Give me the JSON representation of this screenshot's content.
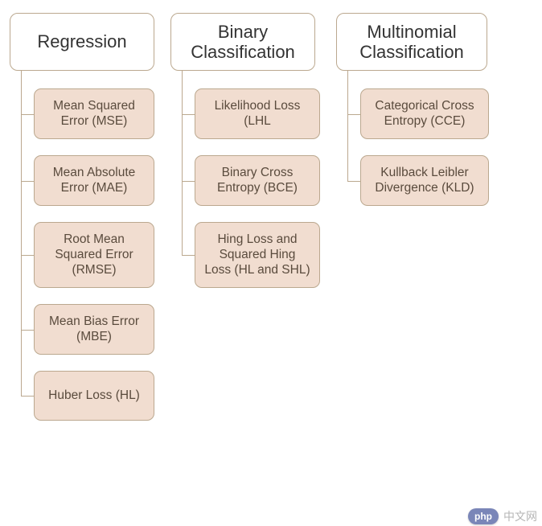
{
  "columns": [
    {
      "id": "regression",
      "title": "Regression",
      "children": [
        "Mean Squared\nError (MSE)",
        "Mean Absolute\nError (MAE)",
        "Root Mean\nSquared Error\n(RMSE)",
        "Mean Bias Error\n(MBE)",
        "Huber Loss (HL)"
      ]
    },
    {
      "id": "binary",
      "title": "Binary\nClassification",
      "children": [
        "Likelihood Loss\n(LHL",
        "Binary Cross\nEntropy (BCE)",
        "Hing Loss and\nSquared Hing\nLoss (HL and SHL)"
      ]
    },
    {
      "id": "multi",
      "title": "Multinomial\nClassification",
      "children": [
        "Categorical Cross\nEntropy (CCE)",
        "Kullback Leibler\nDivergence (KLD)"
      ]
    }
  ],
  "watermark": {
    "badge": "php",
    "text": "中文网"
  },
  "colors": {
    "line": "#bba88f",
    "childFill": "#f1ddd0"
  }
}
